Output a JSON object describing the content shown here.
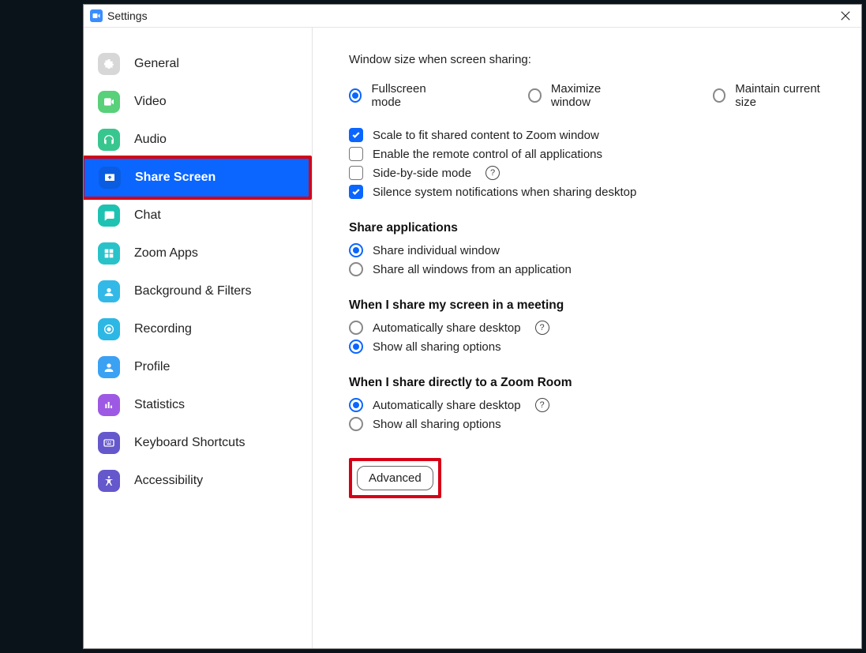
{
  "window": {
    "title": "Settings"
  },
  "sidebar": {
    "items": [
      {
        "key": "general",
        "label": "General"
      },
      {
        "key": "video",
        "label": "Video"
      },
      {
        "key": "audio",
        "label": "Audio"
      },
      {
        "key": "share-screen",
        "label": "Share Screen",
        "selected": true,
        "highlighted": true
      },
      {
        "key": "chat",
        "label": "Chat"
      },
      {
        "key": "zoom-apps",
        "label": "Zoom Apps"
      },
      {
        "key": "background-filters",
        "label": "Background & Filters"
      },
      {
        "key": "recording",
        "label": "Recording"
      },
      {
        "key": "profile",
        "label": "Profile"
      },
      {
        "key": "statistics",
        "label": "Statistics"
      },
      {
        "key": "keyboard-shortcuts",
        "label": "Keyboard Shortcuts"
      },
      {
        "key": "accessibility",
        "label": "Accessibility"
      }
    ]
  },
  "content": {
    "window_size_label": "Window size when screen sharing:",
    "window_size_options": {
      "fullscreen": "Fullscreen mode",
      "maximize": "Maximize window",
      "maintain": "Maintain current size"
    },
    "checkboxes": {
      "scale_fit": "Scale to fit shared content to Zoom window",
      "remote_control": "Enable the remote control of all applications",
      "side_by_side": "Side-by-side mode",
      "silence_notifs": "Silence system notifications when sharing desktop"
    },
    "share_applications": {
      "heading": "Share applications",
      "individual": "Share individual window",
      "all_windows": "Share all windows from an application"
    },
    "share_meeting": {
      "heading": "When I share my screen in a meeting",
      "auto": "Automatically share desktop",
      "show_all": "Show all sharing options"
    },
    "share_room": {
      "heading": "When I share directly to a Zoom Room",
      "auto": "Automatically share desktop",
      "show_all": "Show all sharing options"
    },
    "advanced_label": "Advanced"
  }
}
